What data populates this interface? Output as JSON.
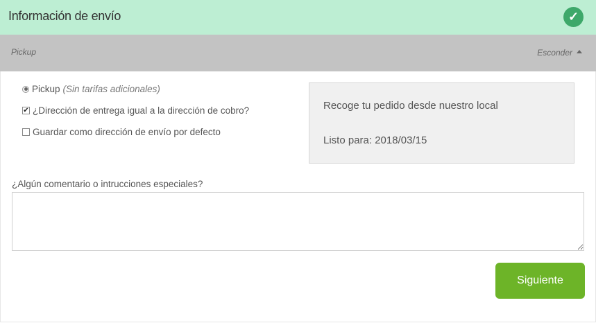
{
  "header": {
    "title": "Información de envío",
    "check_icon": "check-circle-icon",
    "check_color": "#3ea86a",
    "bg_color": "#bdeed3"
  },
  "subbar": {
    "method": "Pickup",
    "hide_label": "Esconder"
  },
  "options": {
    "pickup": {
      "label": "Pickup",
      "hint": "(Sin tarifas adicionales)",
      "checked": true
    },
    "same_address": {
      "label": "¿Dirección de entrega igual a la dirección de cobro?",
      "checked": true
    },
    "save_default": {
      "label": "Guardar como dirección de envío por defecto",
      "checked": false
    }
  },
  "pickup_info": {
    "line1": "Recoge tu pedido desde nuestro local",
    "line2": "Listo para: 2018/03/15"
  },
  "comments": {
    "label": "¿Algún comentario o intrucciones especiales?",
    "value": ""
  },
  "next_button": {
    "label": "Siguiente",
    "color": "#6db428"
  }
}
